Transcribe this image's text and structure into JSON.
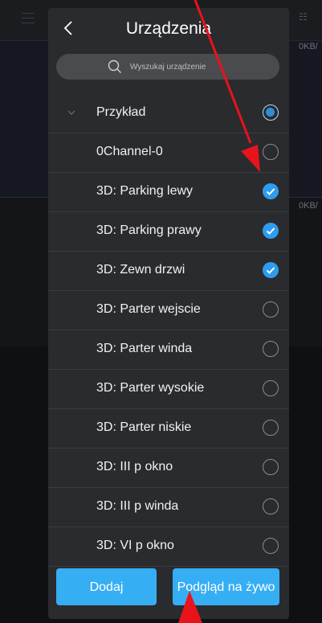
{
  "background": {
    "kb_top": "0KB/",
    "kb_mid": "0KB/"
  },
  "modal": {
    "title": "Urządzenia",
    "search_placeholder": "Wyszukaj urządzenie",
    "group": {
      "label": "Przykład",
      "expanded": true,
      "selected": true
    },
    "items": [
      {
        "label": "0Channel-0",
        "checked": false
      },
      {
        "label": "3D: Parking lewy",
        "checked": true
      },
      {
        "label": "3D: Parking prawy",
        "checked": true
      },
      {
        "label": "3D: Zewn drzwi",
        "checked": true
      },
      {
        "label": "3D: Parter wejscie",
        "checked": false
      },
      {
        "label": "3D: Parter winda",
        "checked": false
      },
      {
        "label": "3D: Parter wysokie",
        "checked": false
      },
      {
        "label": "3D: Parter niskie",
        "checked": false
      },
      {
        "label": "3D: III p okno",
        "checked": false
      },
      {
        "label": "3D: III p winda",
        "checked": false
      },
      {
        "label": "3D: VI p okno",
        "checked": false
      }
    ],
    "add_button": "Dodaj",
    "live_button": "Podgląd na żywo"
  },
  "colors": {
    "accent": "#35aef4",
    "annotation": "#e8131b"
  }
}
